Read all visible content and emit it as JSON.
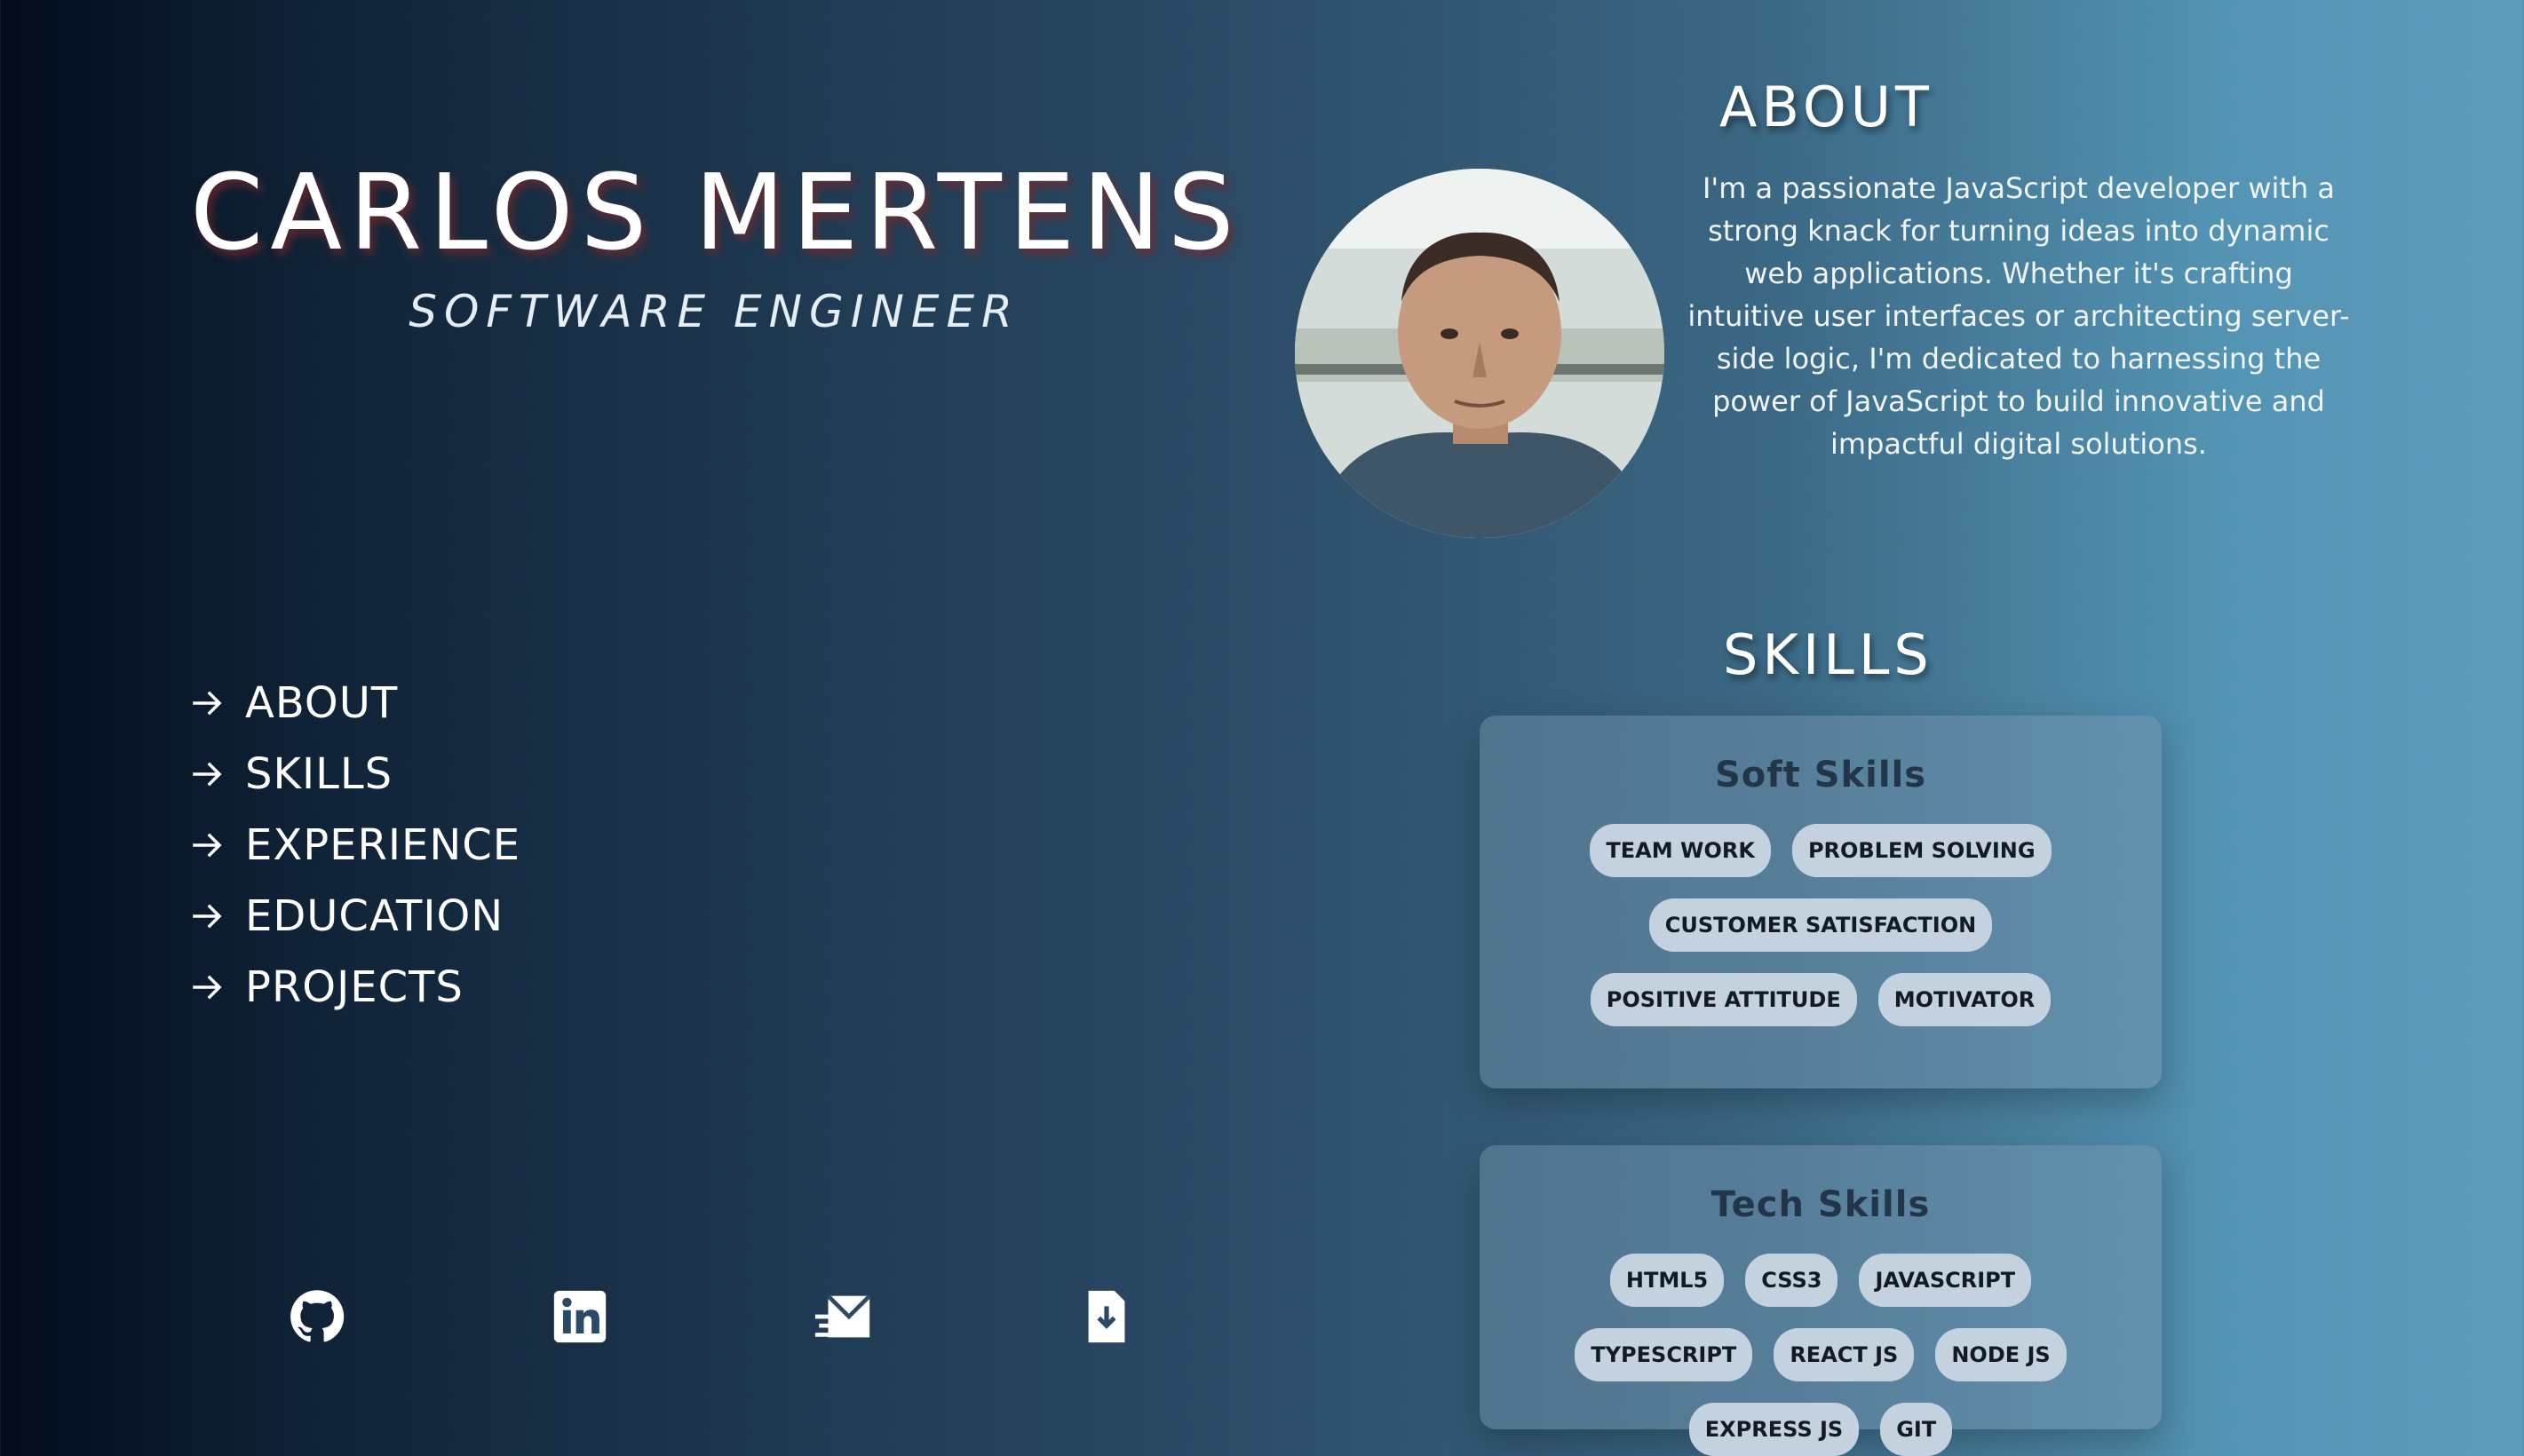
{
  "header": {
    "name": "CARLOS MERTENS",
    "role": "SOFTWARE ENGINEER"
  },
  "nav": {
    "items": [
      {
        "label": "ABOUT"
      },
      {
        "label": "SKILLS"
      },
      {
        "label": "EXPERIENCE"
      },
      {
        "label": "EDUCATION"
      },
      {
        "label": "PROJECTS"
      }
    ]
  },
  "socials": [
    "github-icon",
    "linkedin-icon",
    "email-icon",
    "download-resume-icon"
  ],
  "about": {
    "title": "ABOUT",
    "text": "I'm a passionate JavaScript developer with a strong knack for turning ideas into dynamic web applications. Whether it's crafting intuitive user interfaces or architecting server-side logic, I'm dedicated to harnessing the power of JavaScript to build innovative and impactful digital solutions."
  },
  "skills": {
    "title": "SKILLS",
    "soft": {
      "title": "Soft Skills",
      "items": [
        "TEAM WORK",
        "PROBLEM SOLVING",
        "CUSTOMER SATISFACTION",
        "POSITIVE ATTITUDE",
        "MOTIVATOR"
      ]
    },
    "tech": {
      "title": "Tech Skills",
      "items": [
        "HTML5",
        "CSS3",
        "JAVASCRIPT",
        "TYPESCRIPT",
        "REACT JS",
        "NODE JS",
        "EXPRESS JS",
        "GIT"
      ]
    }
  },
  "colors": {
    "chip_bg": "#c4d2e0",
    "card_title": "#233548",
    "name_shadow": "#782828"
  }
}
